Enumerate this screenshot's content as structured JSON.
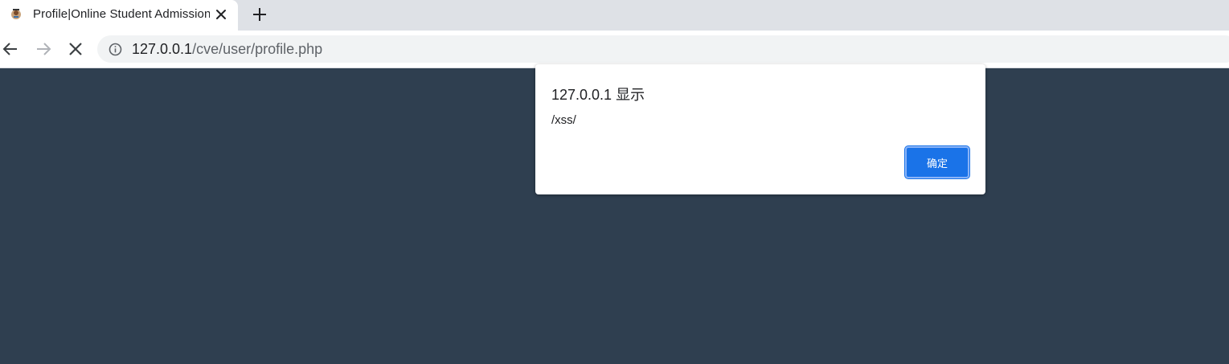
{
  "tab": {
    "title": "Profile|Online Student Admission",
    "favicon": "app-favicon-icon",
    "close_icon": "close-icon"
  },
  "new_tab_icon": "plus-icon",
  "toolbar": {
    "back_icon": "arrow-left-icon",
    "forward_icon": "arrow-right-icon",
    "stop_icon": "stop-loading-icon",
    "info_icon": "info-icon",
    "url_host": "127.0.0.1",
    "url_path": "/cve/user/profile.php"
  },
  "dialog": {
    "title": "127.0.0.1 显示",
    "message": "/xss/",
    "ok_label": "确定"
  },
  "colors": {
    "page_background": "#2f3f50",
    "button_primary": "#1a73e8",
    "tabstrip": "#dee1e6",
    "omnibox": "#f1f3f4"
  }
}
